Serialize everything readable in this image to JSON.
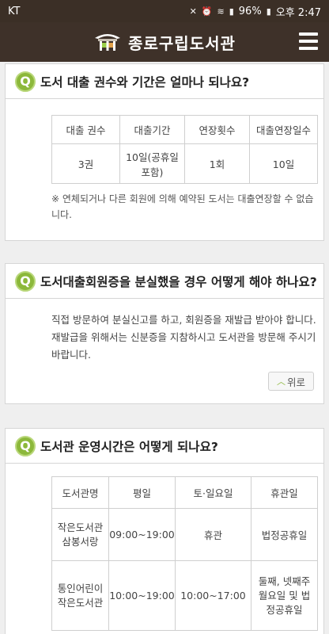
{
  "status": {
    "carrier": "KT",
    "battery": "96%",
    "time": "오후 2:47"
  },
  "header": {
    "title": "종로구립도서관"
  },
  "faq": [
    {
      "badge": "Q",
      "question": "도서 대출 권수와 기간은 얼마나 되나요?",
      "table": {
        "headers": [
          "대출 권수",
          "대출기간",
          "연장횟수",
          "대출연장일수"
        ],
        "row": [
          "3권",
          "10일(공휴일 포함)",
          "1회",
          "10일"
        ]
      },
      "note": "※ 연체되거나 다른 회원에 의해 예약된 도서는 대출연장할 수 없습니다."
    },
    {
      "badge": "Q",
      "question": "도서대출회원증을 분실했을 경우 어떻게 해야 하나요?",
      "answer": "직접 방문하여 분실신고를 하고, 회원증을 재발급 받아야 합니다. 재발급을 위해서는 신분증을 지참하시고 도서관을 방문해 주시기 바랍니다.",
      "top_label": "위로"
    },
    {
      "badge": "Q",
      "question": "도서관 운영시간은 어떻게 되나요?",
      "table": {
        "headers": [
          "도서관명",
          "평일",
          "토·일요일",
          "휴관일"
        ],
        "rows": [
          [
            "작은도서관 삼봉서랑",
            "09:00~19:00",
            "휴관",
            "법정공휴일"
          ],
          [
            "통인어린이 작은도서관",
            "10:00~19:00",
            "10:00~17:00",
            "둘째, 넷째주 월요일 및 법정공휴일"
          ]
        ]
      }
    }
  ],
  "colors": {
    "header_bg": "#3e3129",
    "accent": "#8cb83b"
  }
}
